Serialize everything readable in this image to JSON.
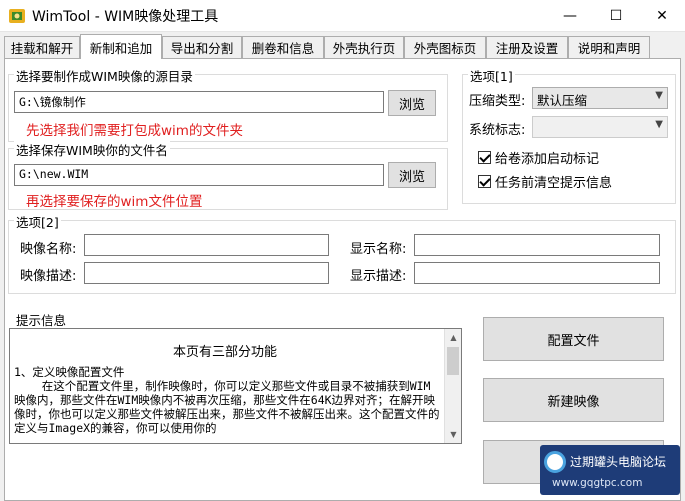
{
  "window": {
    "title": "WimTool - WIM映像处理工具",
    "min_glyph": "—",
    "max_glyph": "☐",
    "close_glyph": "✕"
  },
  "tabs": [
    {
      "label": "挂载和解开"
    },
    {
      "label": "新制和追加",
      "active": true
    },
    {
      "label": "导出和分割"
    },
    {
      "label": "删卷和信息"
    },
    {
      "label": "外壳执行页"
    },
    {
      "label": "外壳图标页"
    },
    {
      "label": "注册及设置"
    },
    {
      "label": "说明和声明"
    }
  ],
  "source": {
    "legend": "选择要制作成WIM映像的源目录",
    "value": "G:\\镜像制作",
    "browse_label": "浏览",
    "hint": "先选择我们需要打包成wim的文件夹"
  },
  "target": {
    "legend": "选择保存WIM映你的文件名",
    "value": "G:\\new.WIM",
    "browse_label": "浏览",
    "hint": "再选择要保存的wim文件位置"
  },
  "options1": {
    "legend": "选项[1]",
    "compression_label": "压缩类型:",
    "compression_value": "默认压缩",
    "flag_label": "系统标志:",
    "flag_value": "",
    "checkbox_boot": "给卷添加启动标记",
    "checkbox_clear": "任务前清空提示信息"
  },
  "options2": {
    "legend": "选项[2]",
    "image_name_label": "映像名称:",
    "display_name_label": "显示名称:",
    "image_desc_label": "映像描述:",
    "display_desc_label": "显示描述:"
  },
  "info": {
    "legend": "提示信息",
    "heading": "本页有三部分功能",
    "body": "1、定义映像配置文件\n    在这个配置文件里，制作映像时，你可以定义那些文件或目录不被捕获到WIM映像内，那些文件在WIM映像内不被再次压缩，那些文件在64K边界对齐；在解开映像时，你也可以定义那些文件被解压出来，那些文件不被解压出来。这个配置文件的定义与ImageX的兼容，你可以使用你的"
  },
  "actions": {
    "config_label": "配置文件",
    "new_image_label": "新建映像"
  },
  "watermark": {
    "line1": "过期罐头电脑论坛",
    "line2": "www.gqgtpc.com"
  },
  "colors": {
    "hint_red": "#e02020",
    "watermark_bg": "#1e3c78"
  }
}
